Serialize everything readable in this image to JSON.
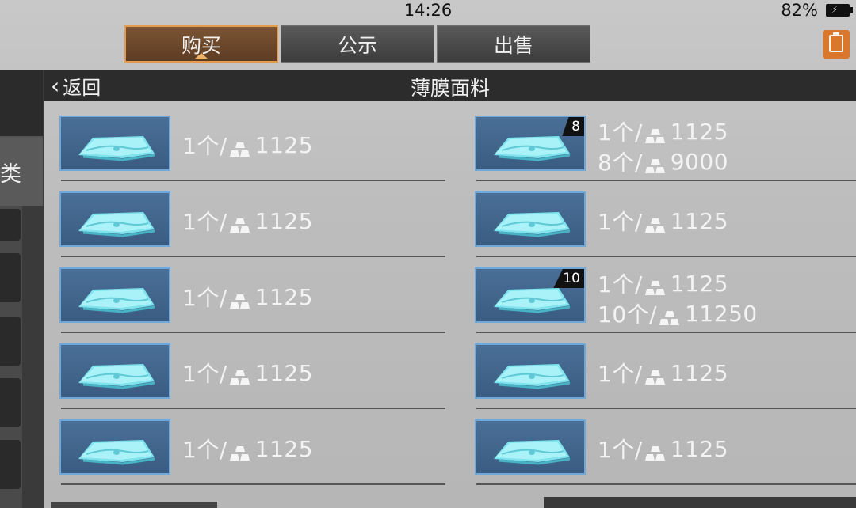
{
  "status": {
    "time": "14:26",
    "battery": "82%"
  },
  "tabs": [
    {
      "label": "购买",
      "active": true
    },
    {
      "label": "公示",
      "active": false
    },
    {
      "label": "出售",
      "active": false
    }
  ],
  "sidebar": {
    "category_fragment": "类"
  },
  "header": {
    "back_label": "返回",
    "title": "薄膜面料"
  },
  "listings": [
    {
      "lines": [
        {
          "qty": "1个/",
          "price": "1125"
        }
      ]
    },
    {
      "badge": "8",
      "lines": [
        {
          "qty": "1个/",
          "price": "1125"
        },
        {
          "qty": "8个/",
          "price": "9000"
        }
      ]
    },
    {
      "lines": [
        {
          "qty": "1个/",
          "price": "1125"
        }
      ]
    },
    {
      "lines": [
        {
          "qty": "1个/",
          "price": "1125"
        }
      ]
    },
    {
      "lines": [
        {
          "qty": "1个/",
          "price": "1125"
        }
      ]
    },
    {
      "badge": "10",
      "lines": [
        {
          "qty": "1个/",
          "price": "1125"
        },
        {
          "qty": "10个/",
          "price": "11250"
        }
      ]
    },
    {
      "lines": [
        {
          "qty": "1个/",
          "price": "1125"
        }
      ]
    },
    {
      "lines": [
        {
          "qty": "1个/",
          "price": "1125"
        }
      ]
    },
    {
      "lines": [
        {
          "qty": "1个/",
          "price": "1125"
        }
      ]
    },
    {
      "lines": [
        {
          "qty": "1个/",
          "price": "1125"
        }
      ]
    }
  ],
  "icons": {
    "currency": "gold-bars-icon",
    "notes": "notes-icon",
    "back": "chevron-left-icon"
  },
  "colors": {
    "accent": "#e39b4c",
    "thumb_border": "#6fa8d8",
    "header_bg": "#2c2c2c"
  }
}
